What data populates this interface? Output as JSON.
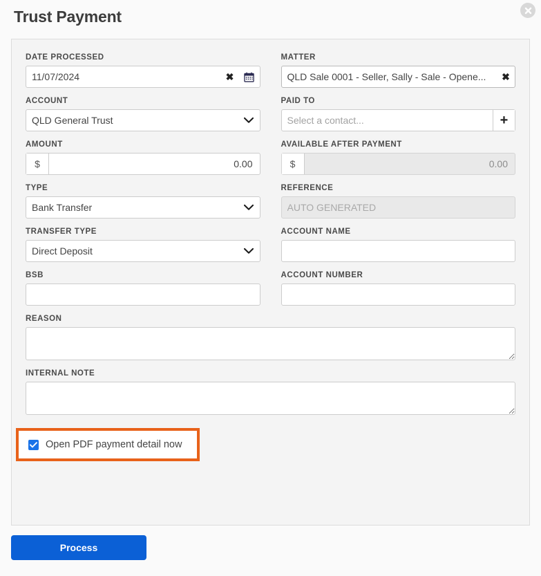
{
  "dialog": {
    "title": "Trust Payment",
    "close_icon": "close-icon"
  },
  "fields": {
    "date_processed": {
      "label": "DATE PROCESSED",
      "value": "11/07/2024",
      "clear_icon": "clear-x-icon",
      "calendar_icon": "calendar-icon"
    },
    "matter": {
      "label": "MATTER",
      "value": "QLD Sale 0001 - Seller, Sally - Sale - Opene...",
      "clear_icon": "clear-x-icon"
    },
    "account": {
      "label": "ACCOUNT",
      "value": "QLD General Trust",
      "chevron_icon": "chevron-down-icon"
    },
    "paid_to": {
      "label": "PAID TO",
      "placeholder": "Select a contact...",
      "value": "",
      "add_icon": "plus-icon"
    },
    "amount": {
      "label": "AMOUNT",
      "prefix": "$",
      "value": "0.00"
    },
    "available_after_payment": {
      "label": "AVAILABLE AFTER PAYMENT",
      "prefix": "$",
      "value": "0.00",
      "disabled": true
    },
    "type": {
      "label": "TYPE",
      "value": "Bank Transfer",
      "chevron_icon": "chevron-down-icon"
    },
    "reference": {
      "label": "REFERENCE",
      "placeholder": "AUTO GENERATED",
      "value": "",
      "disabled": true
    },
    "transfer_type": {
      "label": "TRANSFER TYPE",
      "value": "Direct Deposit",
      "chevron_icon": "chevron-down-icon"
    },
    "account_name": {
      "label": "ACCOUNT NAME",
      "value": ""
    },
    "bsb": {
      "label": "BSB",
      "value": ""
    },
    "account_number": {
      "label": "ACCOUNT NUMBER",
      "value": ""
    },
    "reason": {
      "label": "REASON",
      "value": ""
    },
    "internal_note": {
      "label": "INTERNAL NOTE",
      "value": ""
    },
    "open_pdf": {
      "label": "Open PDF payment detail now",
      "checked": true
    }
  },
  "footer": {
    "process_label": "Process"
  },
  "colors": {
    "highlight": "#e8621a",
    "primary": "#0b60d6",
    "checkbox": "#1a73e8",
    "panel_bg": "#f4f4f4"
  }
}
